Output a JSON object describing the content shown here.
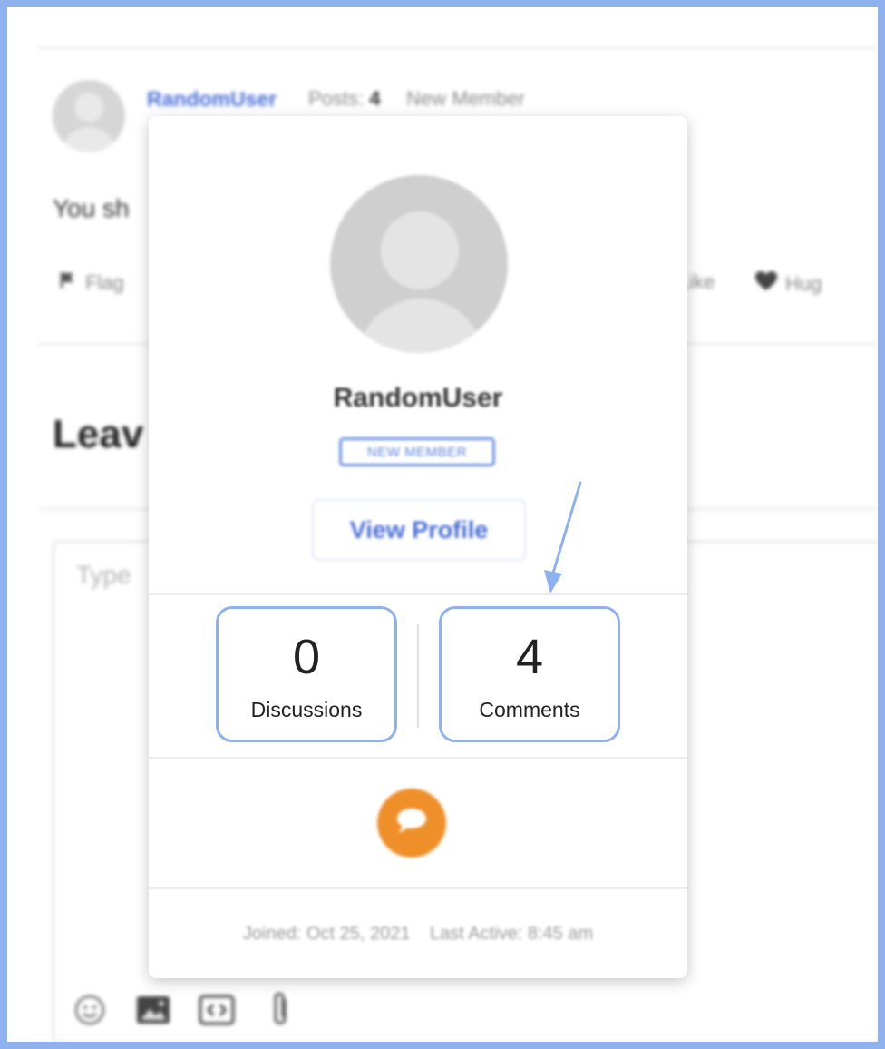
{
  "post": {
    "author_name": "RandomUser",
    "posts_label": "Posts:",
    "posts_count": "4",
    "rank": "New Member",
    "text": "You sh",
    "actions": [
      {
        "icon": "flag-icon",
        "label": "Flag"
      },
      {
        "icon": "like-icon",
        "label": "Like"
      },
      {
        "icon": "heart-icon",
        "label": "Hug"
      }
    ]
  },
  "reply": {
    "title": "Leav",
    "placeholder": "Type",
    "tools": [
      "emoji-icon",
      "image-icon",
      "code-icon",
      "attachment-icon"
    ]
  },
  "profile_card": {
    "name": "RandomUser",
    "rank_badge": "NEW MEMBER",
    "view_profile_label": "View Profile",
    "stats": [
      {
        "value": "0",
        "label": "Discussions"
      },
      {
        "value": "4",
        "label": "Comments"
      }
    ],
    "message_icon": "speech-bubble-icon",
    "joined": "Joined: Oct 25, 2021",
    "last_active": "Last Active: 8:45 am"
  },
  "colors": {
    "frame_border": "#8fb1ee",
    "link_blue": "#4a6fd6",
    "highlight": "#8fb1ee",
    "message_orange": "#ef8f2a"
  }
}
